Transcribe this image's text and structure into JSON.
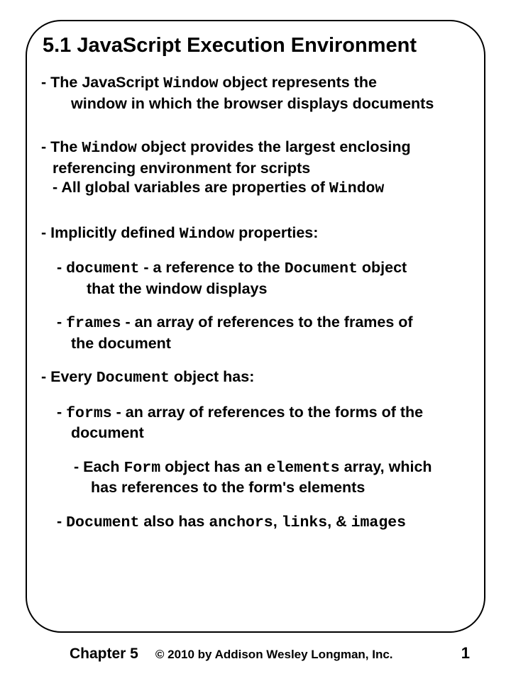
{
  "slide": {
    "title": "5.1 JavaScript Execution Environment",
    "lines": {
      "l1a": "- The JavaScript ",
      "l1b": "Window",
      "l1c": " object represents the",
      "l1d": "window in which the browser displays documents",
      "l2a": "- The ",
      "l2b": "Window",
      "l2c": " object provides the largest enclosing",
      "l2d": "referencing environment for scripts",
      "l2e": "- All global variables are properties of ",
      "l2f": "Window",
      "l3a": "- Implicitly defined ",
      "l3b": "Window",
      "l3c": " properties:",
      "l4a": "- ",
      "l4b": "document",
      "l4c": " - a reference to the ",
      "l4d": "Document",
      "l4e": " object",
      "l4f": "that the window displays",
      "l5a": "- ",
      "l5b": "frames",
      "l5c": " - an array of references to the frames of",
      "l5d": "the document",
      "l6a": "- Every ",
      "l6b": "Document",
      "l6c": " object has:",
      "l7a": "- ",
      "l7b": "forms",
      "l7c": " - an array of references to the forms of the",
      "l7d": "document",
      "l8a": "- Each ",
      "l8b": "Form",
      "l8c": " object has an ",
      "l8d": "elements",
      "l8e": " array, which",
      "l8f": "has references to the form's elements",
      "l9a": "- ",
      "l9b": "Document",
      "l9c": " also has ",
      "l9d": "anchors",
      "l9e": ", ",
      "l9f": "links",
      "l9g": ",  & ",
      "l9h": "images"
    }
  },
  "footer": {
    "chapter": "Chapter 5",
    "copyright": "© 2010 by Addison Wesley Longman, Inc.",
    "page": "1"
  }
}
